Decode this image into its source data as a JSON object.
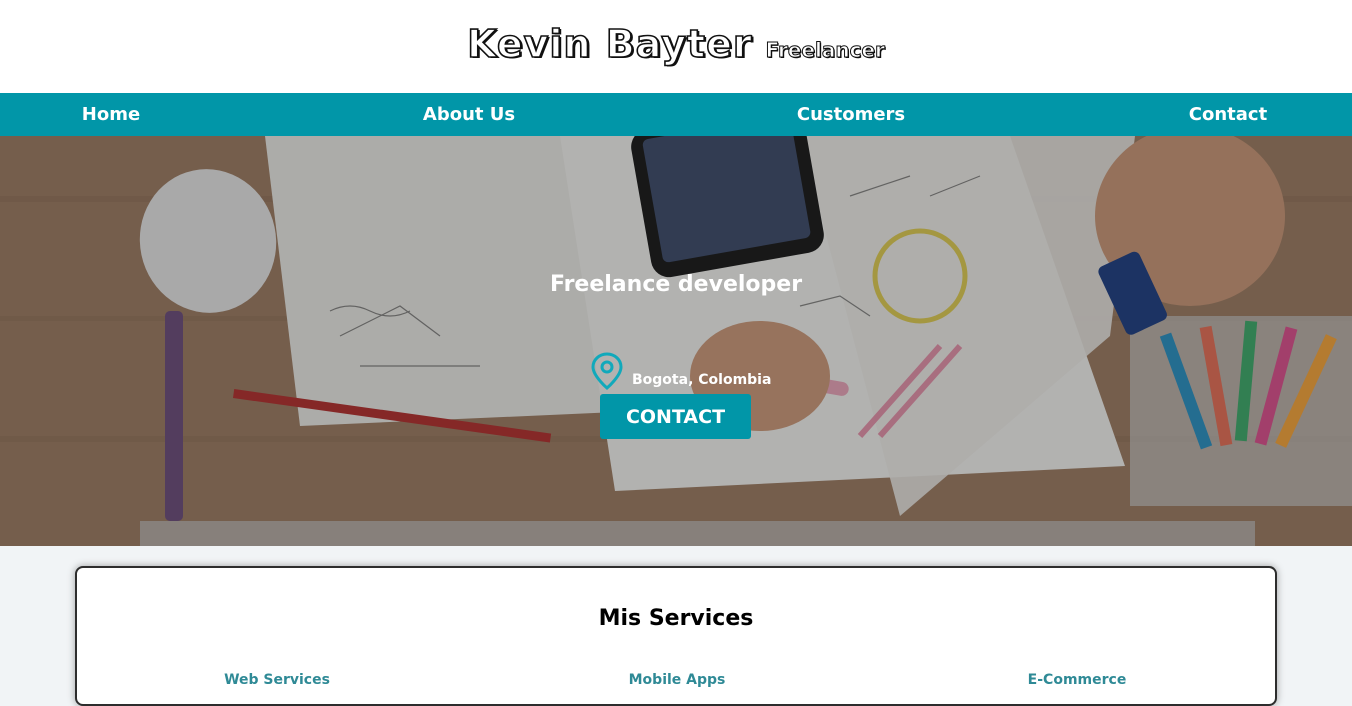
{
  "header": {
    "name": "Kevin Bayter",
    "role": "Freelancer"
  },
  "nav": {
    "items": [
      {
        "label": "Home"
      },
      {
        "label": "About Us"
      },
      {
        "label": "Customers"
      },
      {
        "label": "Contact"
      }
    ]
  },
  "hero": {
    "title": "Freelance developer",
    "location": "Bogota, Colombia",
    "location_icon": "map-pin-icon",
    "cta_label": "CONTACT"
  },
  "services": {
    "title": "Mis Services",
    "items": [
      {
        "label": "Web Services"
      },
      {
        "label": "Mobile Apps"
      },
      {
        "label": "E-Commerce"
      }
    ]
  },
  "colors": {
    "accent": "#0196a8",
    "header_bg": "#ffffff",
    "page_bg": "#f1f4f6"
  }
}
